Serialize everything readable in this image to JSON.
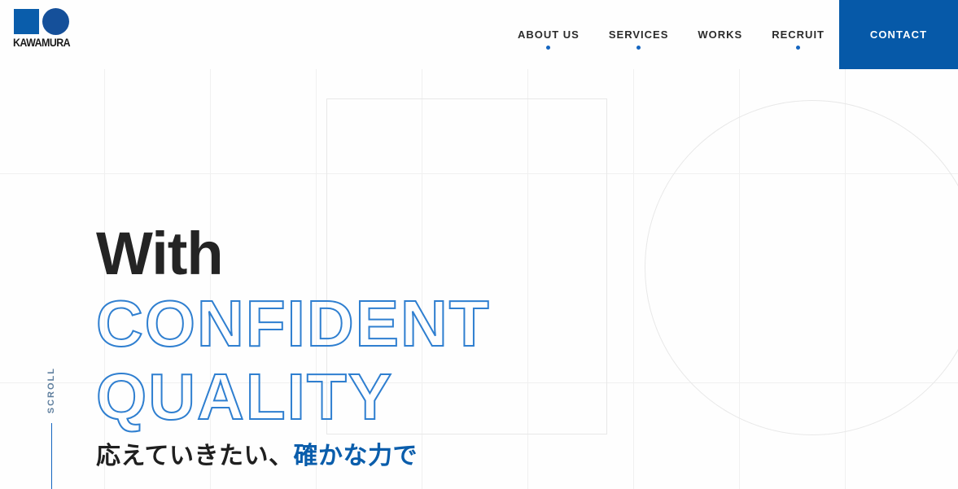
{
  "brand": {
    "logo_word": "KAWAMURA",
    "logo_square_icon": "blue-square",
    "logo_circle_icon": "blue-circle",
    "primary_color": "#0659a8",
    "accent_color": "#1565c0",
    "outline_color": "#2f7fd0"
  },
  "nav": {
    "items": [
      {
        "label": "ABOUT US",
        "has_dot": true
      },
      {
        "label": "SERVICES",
        "has_dot": true
      },
      {
        "label": "WORKS",
        "has_dot": false
      },
      {
        "label": "RECRUIT",
        "has_dot": true
      }
    ],
    "contact_label": "CONTACT"
  },
  "hero": {
    "line1": "With",
    "line2": "CONFIDENT",
    "line3": "QUALITY",
    "sub_dark": "応えていきたい、",
    "sub_accent": "確かな力で"
  },
  "scroll": {
    "label": "SCROLL"
  },
  "decor": {
    "square_outline": "decorative-square",
    "circle_outline": "decorative-circle",
    "grid_color": "#f0f0f0"
  }
}
